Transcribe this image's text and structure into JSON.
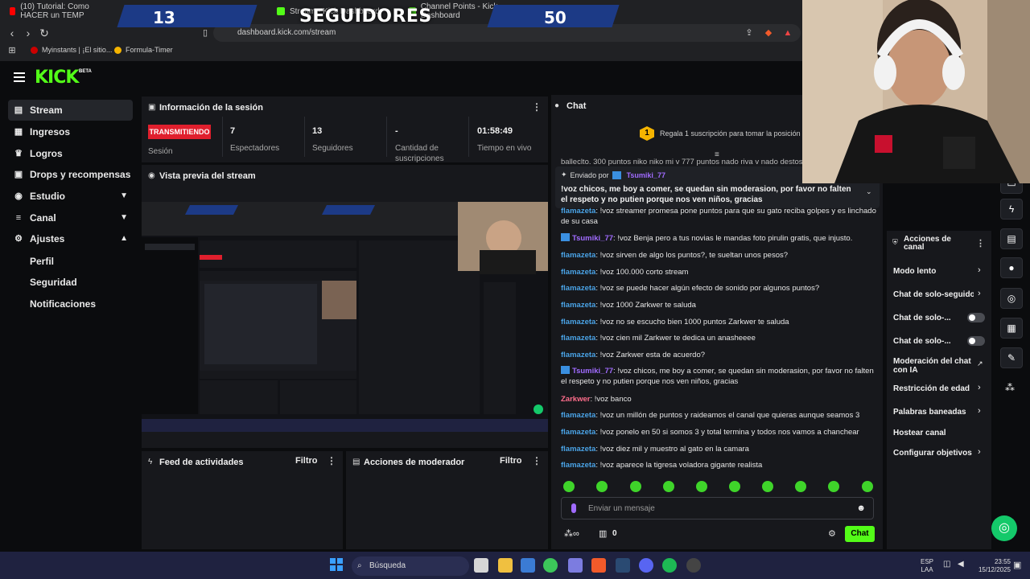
{
  "browser": {
    "tabs": [
      {
        "label": "(10) Tutorial: Como HACER un TEMP"
      },
      {
        "label": "Stream - Kick Dashboard"
      },
      {
        "label": "Channel Points - Kick Dashboard"
      }
    ],
    "url": "dashboard.kick.com/stream",
    "bookmarks": [
      "Myinstants | ¡El sitio...",
      "Formula-Timer"
    ]
  },
  "overlay": {
    "left_count": "13",
    "title": "SEGUIDORES",
    "right_count": "50"
  },
  "header": {
    "logo": "KICK",
    "logo_badge": "BETA"
  },
  "sidebar": {
    "items": [
      {
        "label": "Stream"
      },
      {
        "label": "Ingresos"
      },
      {
        "label": "Logros"
      },
      {
        "label": "Drops y recompensas"
      },
      {
        "label": "Estudio"
      },
      {
        "label": "Canal"
      },
      {
        "label": "Ajustes"
      }
    ],
    "sub_items": [
      "Perfil",
      "Seguridad",
      "Notificaciones"
    ]
  },
  "session": {
    "title": "Información de la sesión",
    "live_badge": "TRANSMITIENDO",
    "session_label": "Sesión",
    "stats": [
      {
        "value": "7",
        "label": "Espectadores"
      },
      {
        "value": "13",
        "label": "Seguidores"
      },
      {
        "value": "-",
        "label": "Cantidad de suscripciones"
      },
      {
        "value": "01:58:49",
        "label": "Tiempo en vivo"
      }
    ]
  },
  "preview": {
    "title": "Vista previa del stream"
  },
  "feed": {
    "title": "Feed de actividades",
    "filter": "Filtro"
  },
  "mod_log": {
    "title": "Acciones de moderador",
    "filter": "Filtro"
  },
  "chat": {
    "title": "Chat",
    "gift_rank": "1",
    "gift_prompt": "Regala 1 suscripción para tomar la posición 1",
    "overflow_line": "balleclto. 300 puntos niko niko mi v 777 puntos nado riva v nado destos d",
    "pinned": {
      "label": "Enviado por",
      "user": "Tsumiki_77",
      "text": "!voz chicos, me boy a comer, se quedan sin moderasion, por favor no falten el respeto y no putien porque nos ven niños, gracias"
    },
    "messages": [
      {
        "user": "flamazeta",
        "kind": "f",
        "text": ": !voz streamer promesa pone puntos para que su gato reciba golpes y es linchado de su casa"
      },
      {
        "user": "Tsumiki_77",
        "kind": "t",
        "text": ": !voz Benja pero a tus novias le mandas foto pirulin gratis, que injusto."
      },
      {
        "user": "flamazeta",
        "kind": "f",
        "text": ": !voz sirven de algo los puntos?, te sueltan unos pesos?"
      },
      {
        "user": "flamazeta",
        "kind": "f",
        "text": ": !voz 100.000 corto stream"
      },
      {
        "user": "flamazeta",
        "kind": "f",
        "text": ": !voz se puede hacer algún efecto de sonido por algunos puntos?"
      },
      {
        "user": "flamazeta",
        "kind": "f",
        "text": ": !voz 1000 Zarkwer te saluda"
      },
      {
        "user": "flamazeta",
        "kind": "f",
        "text": ": !voz no se escucho bien 1000 puntos Zarkwer te saluda"
      },
      {
        "user": "flamazeta",
        "kind": "f",
        "text": ": !voz cien mil Zarkwer te dedica un anasheeee"
      },
      {
        "user": "flamazeta",
        "kind": "f",
        "text": ": !voz Zarkwer esta de acuerdo?"
      },
      {
        "user": "Tsumiki_77",
        "kind": "t",
        "text": ": !voz chicos, me boy a comer, se quedan sin moderasion, por favor no falten el respeto y no putien porque nos ven niños, gracias"
      },
      {
        "user": "Zarkwer",
        "kind": "z",
        "text": ": !voz banco"
      },
      {
        "user": "flamazeta",
        "kind": "f",
        "text": ": !voz un millón de puntos y raideamos el canal que quieras aunque seamos 3"
      },
      {
        "user": "flamazeta",
        "kind": "f",
        "text": ": !voz ponelo en 50 si somos 3 y total termina y todos nos vamos a chanchear"
      },
      {
        "user": "flamazeta",
        "kind": "f",
        "text": ": !voz diez mil y muestro al gato en la camara"
      },
      {
        "user": "flamazeta",
        "kind": "f",
        "text": ": !voz aparece la tigresa voladora gigante realista"
      }
    ],
    "input_placeholder": "Enviar un mensaje",
    "points": "0",
    "send_label": "Chat"
  },
  "mod_actions": {
    "title": "Acciones de canal",
    "items": [
      {
        "label": "Modo lento"
      },
      {
        "label": "Chat de solo-seguidor"
      },
      {
        "label": "Chat de solo-..."
      },
      {
        "label": "Chat de solo-..."
      },
      {
        "label": "Moderación del chat con IA"
      },
      {
        "label": "Restricción de edad"
      },
      {
        "label": "Palabras baneadas"
      },
      {
        "label": "Hostear canal"
      },
      {
        "label": "Configurar objetivos"
      }
    ]
  },
  "taskbar": {
    "search": "Búsqueda",
    "lang_top": "ESP",
    "lang_bottom": "LAA",
    "time": "23:55",
    "date": "15/12/2025"
  },
  "colors": {
    "kick_green": "#53fc18",
    "live_red": "#e01f2d",
    "panel_bg": "#17181c",
    "user_blue": "#4aa3e6",
    "user_purple": "#a06bff",
    "user_pink": "#ff6d8b"
  }
}
